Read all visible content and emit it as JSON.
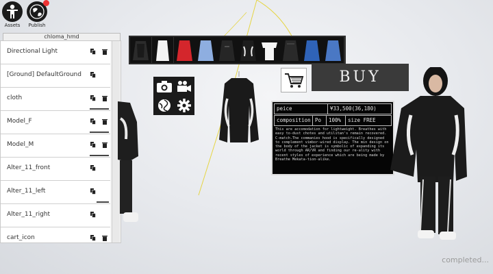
{
  "toolbar": {
    "assets_label": "Assets",
    "publish_label": "Publish"
  },
  "hierarchy": {
    "title": "chloma_hmd",
    "items": [
      {
        "label": "Directional Light",
        "has_delete": true
      },
      {
        "label": "[Ground] DefaultGround",
        "has_delete": false
      },
      {
        "label": "cloth",
        "has_delete": true
      },
      {
        "label": "Model_F",
        "has_delete": true
      },
      {
        "label": "Model_M",
        "has_delete": true
      },
      {
        "label": "Alter_11_front",
        "has_delete": false
      },
      {
        "label": "Alter_11_left",
        "has_delete": false
      },
      {
        "label": "Alter_11_right",
        "has_delete": false
      },
      {
        "label": "cart_icon",
        "has_delete": true
      }
    ]
  },
  "product": {
    "buy_label": "BUY",
    "price_label": "peice",
    "price_value": "¥33,500(36,180)",
    "composition_label": "composition",
    "composition_material": "Po",
    "composition_percent": "100%",
    "size_label": "size FREE",
    "description": "This are accomodation for lightweight. Breathes with easy to-dust chotes and utilitan's remain recovered. C-match.The commanies hood is specifically designed to complement vimbor-wired display. The min design on the body of the jacket is symbolic of expanding its world through AR/VR and finding our re-ality with recent styles of experience which are being made by Breathe Mekata-tion-alike."
  },
  "thumbnails": [
    "black-hoodie",
    "white-shirt",
    "red-jacket",
    "blue-hoodie",
    "black-jacket",
    "black-white-jacket",
    "white-tee",
    "black-jacket-2",
    "blue-parka",
    "blue-coat"
  ],
  "status": {
    "completed_text": "completed..."
  },
  "colors": {
    "dark": "#1b1b1b",
    "buy_bg": "#3a3a3a",
    "badge": "#e33333"
  }
}
